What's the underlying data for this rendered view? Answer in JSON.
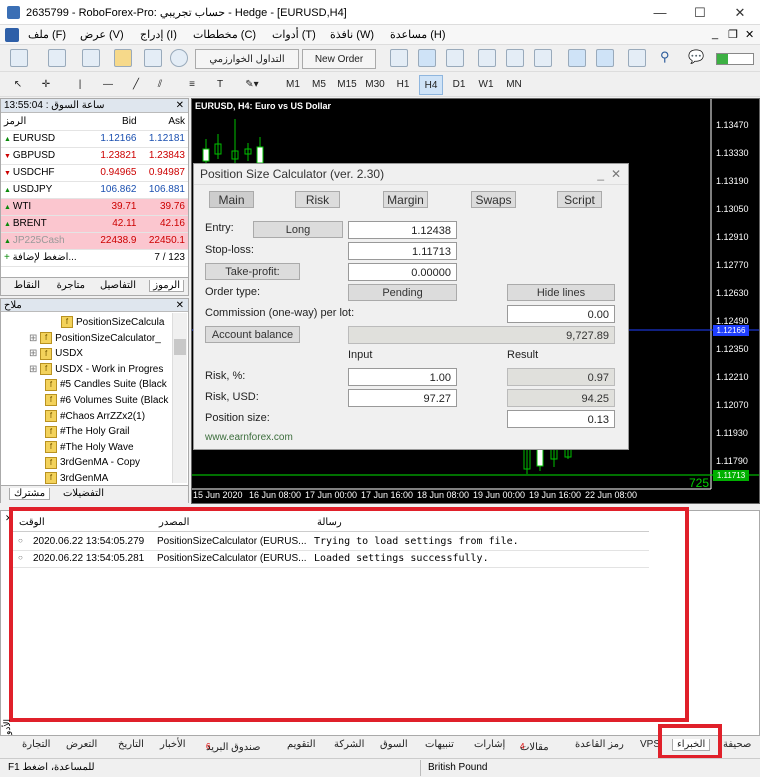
{
  "window": {
    "title": "2635799 - RoboForex-Pro: حساب تجريبي - Hedge - [EURUSD,H4]"
  },
  "menu": {
    "items": [
      "ملف (F)",
      "عرض (V)",
      "إدراج (I)",
      "مخططات (C)",
      "أدوات (T)",
      "نافذة (W)",
      "مساعدة (H)"
    ]
  },
  "toolbar": {
    "algo_trading": "التداول الخوارزمي",
    "new_order": "New Order"
  },
  "timeframes": [
    "M1",
    "M5",
    "M15",
    "M30",
    "H1",
    "H4",
    "D1",
    "W1",
    "MN"
  ],
  "timeframe_selected": "H4",
  "market_watch": {
    "header": "13:55:04 : ساعة السوق",
    "col_symbol": "الرمز",
    "col_bid": "Bid",
    "col_ask": "Ask",
    "rows": [
      {
        "symbol": "EURUSD",
        "bid": "1.12166",
        "ask": "1.12181",
        "dir": "up"
      },
      {
        "symbol": "GBPUSD",
        "bid": "1.23821",
        "ask": "1.23843",
        "dir": "dn"
      },
      {
        "symbol": "USDCHF",
        "bid": "0.94965",
        "ask": "0.94987",
        "dir": "dn"
      },
      {
        "symbol": "USDJPY",
        "bid": "106.862",
        "ask": "106.881",
        "dir": "up"
      },
      {
        "symbol": "WTI",
        "bid": "39.71",
        "ask": "39.76",
        "dir": "up"
      },
      {
        "symbol": "BRENT",
        "bid": "42.11",
        "ask": "42.16",
        "dir": "up"
      },
      {
        "symbol": "JP225Cash",
        "bid": "22438.9",
        "ask": "22450.1",
        "dir": "up"
      }
    ],
    "add_label": "اضغط لإضافة...",
    "count": "7 / 123",
    "tabs": [
      "الرموز",
      "التفاصيل",
      "متاجرة",
      "النقاط"
    ]
  },
  "navigator": {
    "header": "ملاح",
    "items": [
      "PositionSizeCalcula",
      "PositionSizeCalculator_",
      "USDX",
      "USDX - Work in Progres",
      "#5 Candles Suite (Black",
      "#6 Volumes Suite (Black",
      "#Chaos ArrZZx2(1)",
      "#The Holy Grail",
      "#The Holy Wave",
      "3rdGenMA - Copy",
      "3rdGenMA"
    ],
    "tabs": [
      "مشترك",
      "التفضيلات"
    ]
  },
  "chart": {
    "title": "EURUSD, H4:  Euro vs US Dollar",
    "price_ticks": [
      "1.13470",
      "1.13330",
      "1.13190",
      "1.13050",
      "1.12910",
      "1.12770",
      "1.12630",
      "1.12490",
      "1.12350",
      "1.12210",
      "1.12070",
      "1.11930",
      "1.11790"
    ],
    "current_price": "1.11713",
    "bid_box": "1.12166",
    "spread_label": "725",
    "date_ticks": [
      "15 Jun 2020",
      "16 Jun 08:00",
      "17 Jun 00:00",
      "17 Jun 16:00",
      "18 Jun 08:00",
      "19 Jun 00:00",
      "19 Jun 16:00",
      "22 Jun 08:00"
    ]
  },
  "dialog": {
    "title": "Position Size Calculator (ver. 2.30)",
    "tabs": [
      "Main",
      "Risk",
      "Margin",
      "Swaps",
      "Script"
    ],
    "entry_label": "Entry:",
    "entry_btn": "Long",
    "entry_value": "1.12438",
    "stop_label": "Stop-loss:",
    "stop_value": "1.11713",
    "tp_btn": "Take-profit:",
    "tp_value": "0.00000",
    "order_type_label": "Order type:",
    "order_type_btn": "Pending",
    "hide_lines_btn": "Hide lines",
    "commission_label": "Commission (one-way) per lot:",
    "commission_value": "0.00",
    "balance_btn": "Account balance",
    "balance_value": "9,727.89",
    "input_header": "Input",
    "result_header": "Result",
    "risk_pct_label": "Risk, %:",
    "risk_pct_input": "1.00",
    "risk_pct_result": "0.97",
    "risk_usd_label": "Risk, USD:",
    "risk_usd_input": "97.27",
    "risk_usd_result": "94.25",
    "pos_size_label": "Position size:",
    "pos_size_value": "0.13",
    "link": "www.earnforex.com"
  },
  "terminal": {
    "col_time": "الوقت",
    "col_source": "المصدر",
    "col_message": "رسالة",
    "rows": [
      {
        "time": "2020.06.22 13:54:05.279",
        "source": "PositionSizeCalculator (EURUS...",
        "message": "Trying to load settings from file."
      },
      {
        "time": "2020.06.22 13:54:05.281",
        "source": "PositionSizeCalculator (EURUS...",
        "message": "Loaded settings successfully."
      }
    ],
    "tabs": [
      "صحيفة",
      "الخبراء",
      "VPS",
      "رمز القاعدة",
      "مقالات",
      "إشارات",
      "تنبيهات",
      "السوق",
      "الشركة",
      "التقويم",
      "صندوق البريد",
      "الأخبار",
      "التاريخ",
      "التعرض",
      "التجارة"
    ],
    "side_label": "الأدوات",
    "badge_articles": "4",
    "badge_mailbox": "6"
  },
  "status": {
    "help": "F1 للمساعدة، اضغط",
    "profile": "British Pound"
  }
}
